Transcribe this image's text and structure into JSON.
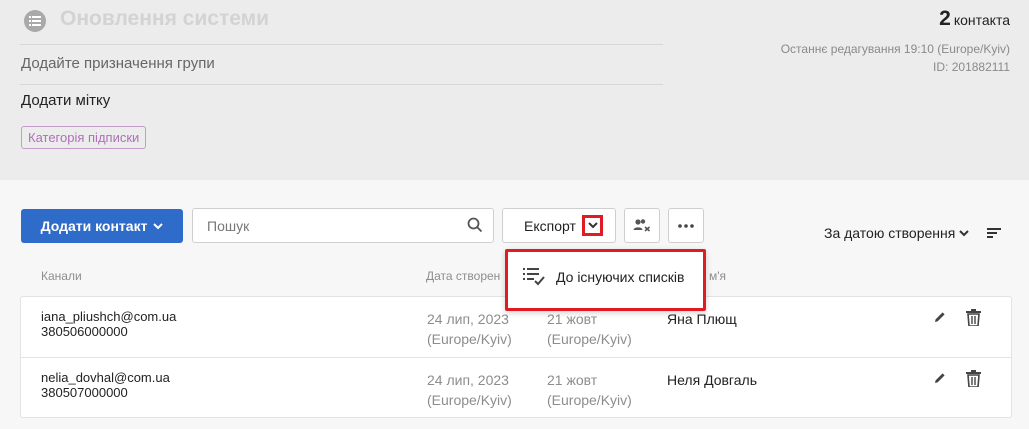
{
  "header": {
    "list_title": "Оновлення системи",
    "purpose_prompt": "Додайте призначення групи",
    "add_tag_label": "Додати мітку",
    "category_tag": "Категорія підписки",
    "contacts_count": "2",
    "contacts_word": "контакта",
    "last_edited": "Останнє редагування 19:10 (Europe/Kyiv)",
    "id_label": "ID:  201882111"
  },
  "toolbar": {
    "add_contact_label": "Додати контакт",
    "search_placeholder": "Пошук",
    "export_label": "Експорт",
    "sort_label": "За датою створення"
  },
  "export_menu": {
    "items": [
      {
        "label": "До існуючих списків",
        "icon": "list-check-icon"
      }
    ]
  },
  "table": {
    "columns": {
      "channels": "Канали",
      "created": "Дата створен",
      "name": "м'я"
    },
    "rows": [
      {
        "email": "iana_pliushch@com.ua",
        "phone": "380506000000",
        "created_date": "24 лип, 2023",
        "created_tz": "(Europe/Kyiv)",
        "second_date": "21 жовт",
        "second_tz": "(Europe/Kyiv)",
        "name": "Яна Плющ"
      },
      {
        "email": "nelia_dovhal@com.ua",
        "phone": "380507000000",
        "created_date": "24 лип, 2023",
        "created_tz": "(Europe/Kyiv)",
        "second_date": "21 жовт",
        "second_tz": "(Europe/Kyiv)",
        "name": "Неля Довгаль"
      }
    ]
  },
  "colors": {
    "primary": "#2f6bc9",
    "highlight": "#e01b24",
    "category_tag": "#b06fb9"
  },
  "icons": [
    "list-icon",
    "chevron-down-icon",
    "search-icon",
    "remove-users-icon",
    "more-icon",
    "sort-icon",
    "list-check-icon",
    "pencil-icon",
    "trash-icon"
  ]
}
